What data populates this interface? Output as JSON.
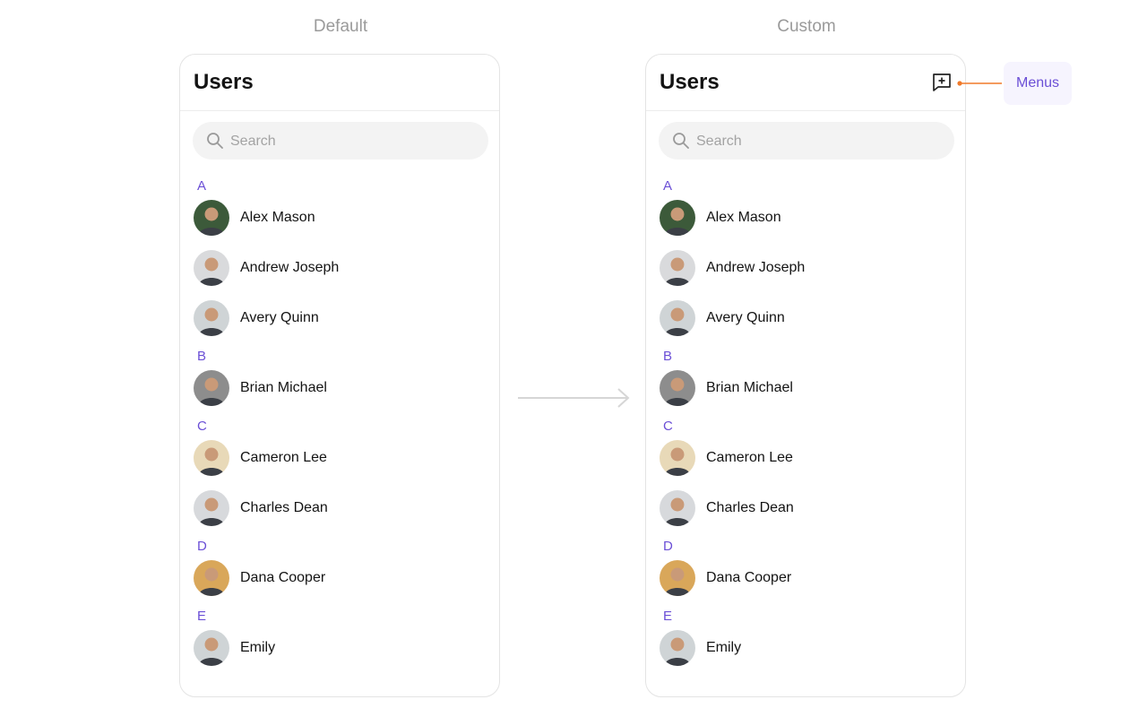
{
  "labels": {
    "default": "Default",
    "custom": "Custom",
    "menus": "Menus"
  },
  "panel": {
    "title": "Users",
    "search_placeholder": "Search"
  },
  "header_action_icon": "message-plus-icon",
  "colors": {
    "accent": "#6B4FD6",
    "callout": "#F07A2A",
    "search_bg": "#F3F3F3",
    "border": "#E4E4E4"
  },
  "groups": [
    {
      "letter": "A",
      "users": [
        {
          "name": "Alex Mason",
          "avatar_bg": "#3c5a3a"
        },
        {
          "name": "Andrew Joseph",
          "avatar_bg": "#d9dadc"
        },
        {
          "name": "Avery Quinn",
          "avatar_bg": "#cfd4d6"
        }
      ]
    },
    {
      "letter": "B",
      "users": [
        {
          "name": "Brian Michael",
          "avatar_bg": "#8d8d8d"
        }
      ]
    },
    {
      "letter": "C",
      "users": [
        {
          "name": "Cameron Lee",
          "avatar_bg": "#e8d9b8"
        },
        {
          "name": "Charles Dean",
          "avatar_bg": "#d7d9dc"
        }
      ]
    },
    {
      "letter": "D",
      "users": [
        {
          "name": "Dana Cooper",
          "avatar_bg": "#d9a75a"
        }
      ]
    },
    {
      "letter": "E",
      "users": [
        {
          "name": "Emily",
          "avatar_bg": "#cfd4d6"
        }
      ]
    }
  ]
}
